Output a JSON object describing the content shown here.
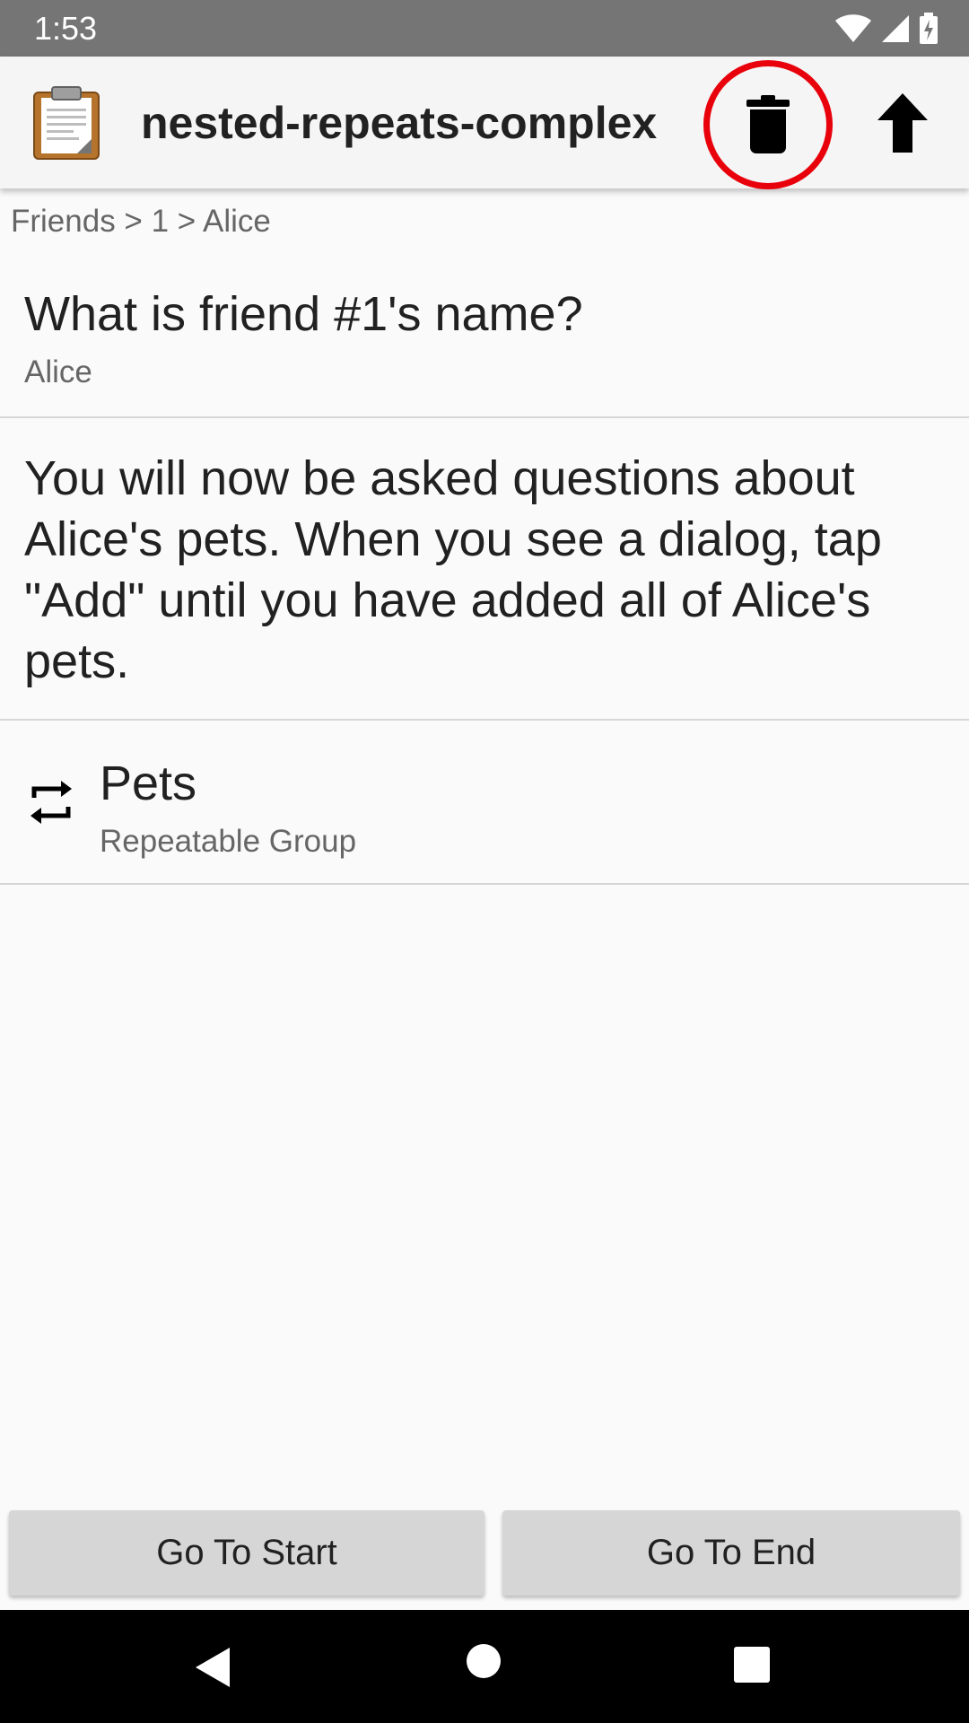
{
  "status_bar": {
    "time": "1:53",
    "icons": [
      "wifi-icon",
      "signal-icon",
      "battery-charging-icon"
    ]
  },
  "toolbar": {
    "title": "nested-repeats-complex",
    "app_icon": "clipboard-icon",
    "actions": [
      "delete-icon",
      "upload-arrow-icon"
    ],
    "highlight_color": "#e8000b"
  },
  "breadcrumb": "Friends > 1 > Alice",
  "question": {
    "label": "What is friend #1's name?",
    "answer": "Alice"
  },
  "note": "You will now be asked questions about Alice's pets. When you see a dialog, tap \"Add\" until you have added all of Alice's pets.",
  "group": {
    "title": "Pets",
    "subtitle": "Repeatable Group",
    "icon": "repeat-icon"
  },
  "buttons": {
    "start_label": "Go To Start",
    "end_label": "Go To End"
  },
  "system_nav": [
    "back-icon",
    "home-icon",
    "recents-icon"
  ]
}
